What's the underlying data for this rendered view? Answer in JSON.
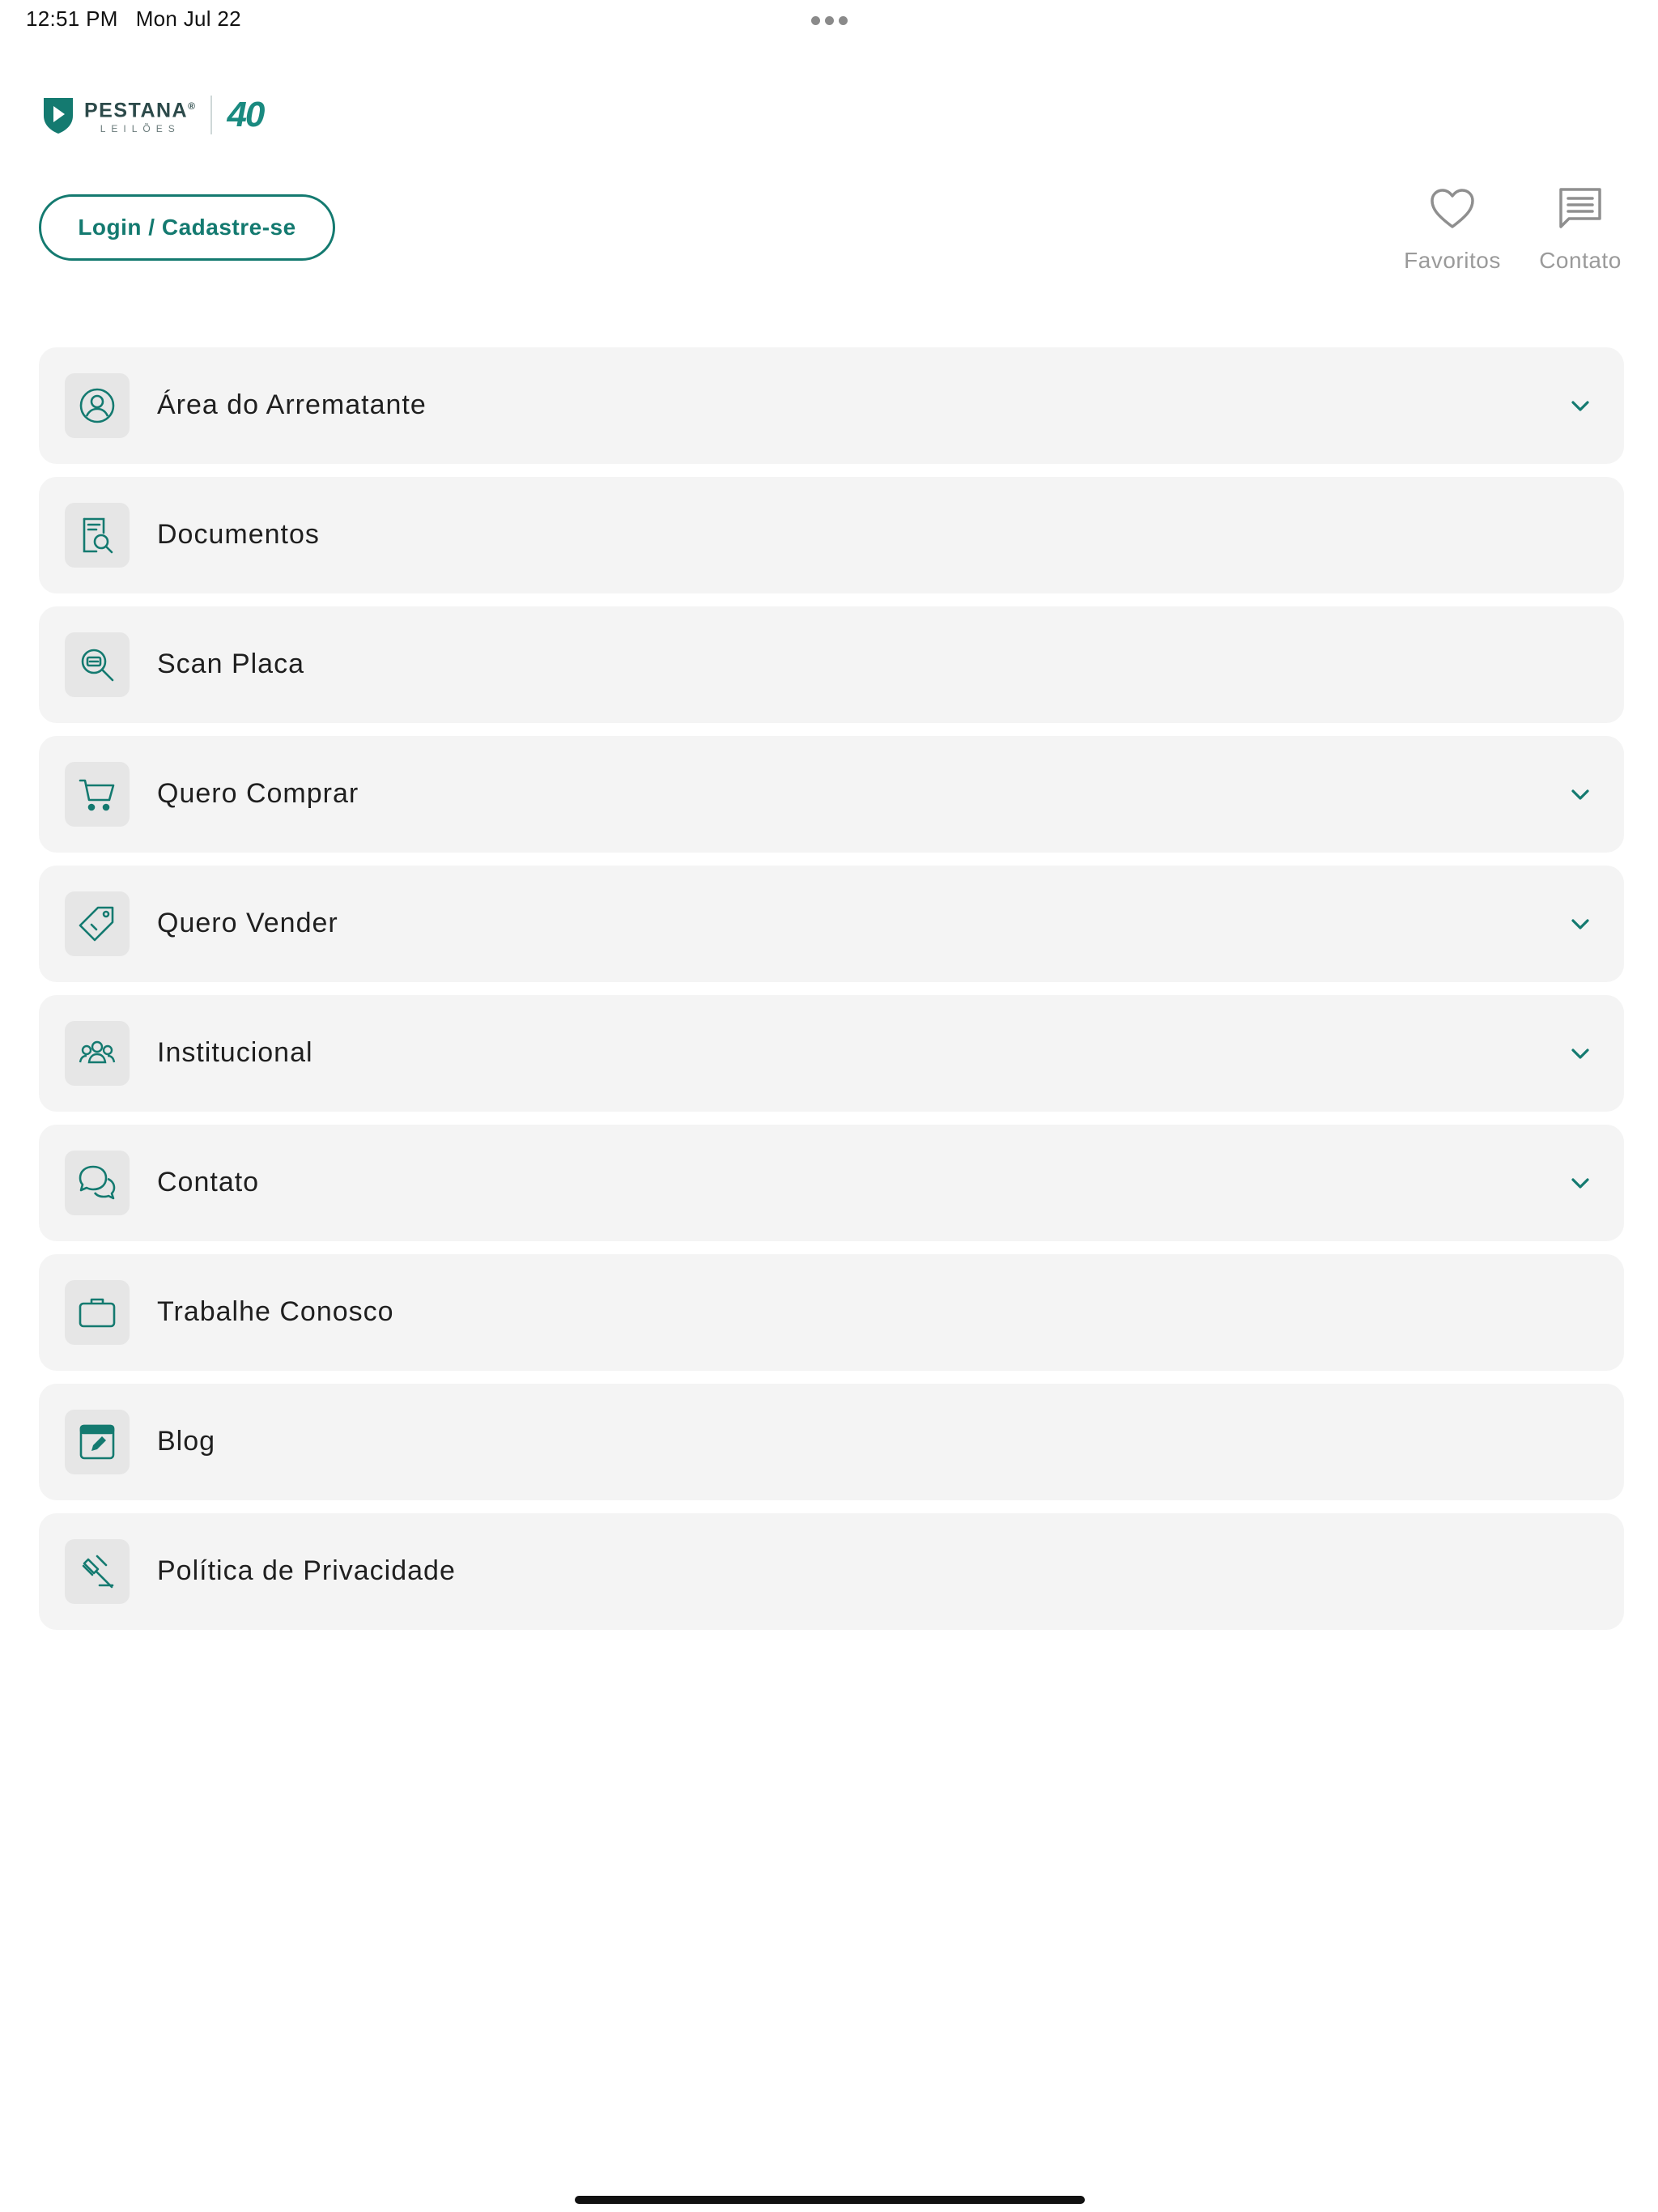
{
  "status_bar": {
    "time": "12:51 PM",
    "date": "Mon Jul 22"
  },
  "brand": {
    "name": "PESTANA",
    "trademark": "®",
    "sub": "LEILÕES",
    "anniversary": "40",
    "color": "#147a70"
  },
  "login": {
    "label": "Login / Cadastre-se"
  },
  "top_actions": {
    "favorites": {
      "label": "Favoritos",
      "icon": "heart-icon"
    },
    "contact": {
      "label": "Contato",
      "icon": "message-icon"
    }
  },
  "menu": {
    "items": [
      {
        "label": "Área do Arrematante",
        "icon": "user-circle-icon",
        "expandable": true
      },
      {
        "label": "Documentos",
        "icon": "document-search-icon",
        "expandable": false
      },
      {
        "label": "Scan Placa",
        "icon": "scan-plate-icon",
        "expandable": false
      },
      {
        "label": "Quero Comprar",
        "icon": "cart-icon",
        "expandable": true
      },
      {
        "label": "Quero Vender",
        "icon": "price-tag-icon",
        "expandable": true
      },
      {
        "label": "Institucional",
        "icon": "group-icon",
        "expandable": true
      },
      {
        "label": "Contato",
        "icon": "chat-bubbles-icon",
        "expandable": true
      },
      {
        "label": "Trabalhe Conosco",
        "icon": "briefcase-icon",
        "expandable": false
      },
      {
        "label": "Blog",
        "icon": "blog-edit-icon",
        "expandable": false
      },
      {
        "label": "Política de Privacidade",
        "icon": "gavel-icon",
        "expandable": false
      }
    ]
  }
}
